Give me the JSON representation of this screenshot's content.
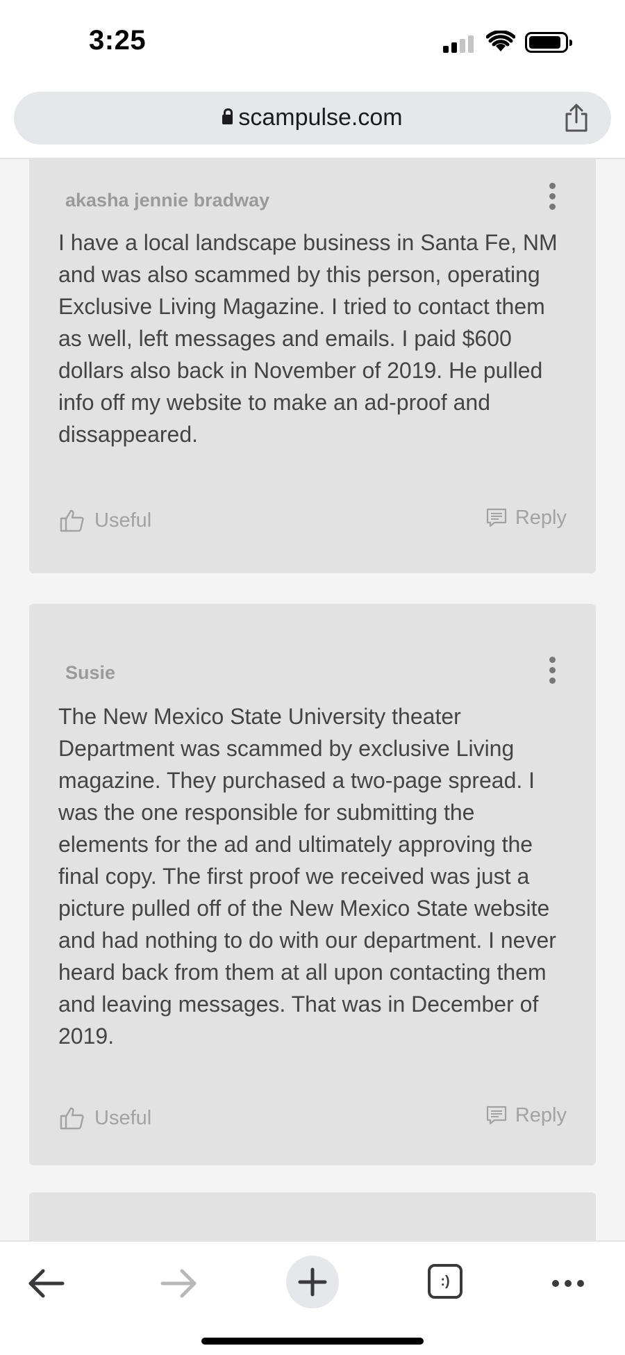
{
  "status_bar": {
    "time": "3:25"
  },
  "browser": {
    "url": "scampulse.com"
  },
  "comments": [
    {
      "author": "akasha jennie bradway",
      "body": "I have a local landscape business in Santa Fe, NM and was also scammed by this person, operating Exclusive Living Magazine. I tried to contact them as well, left messages and emails. I paid $600 dollars also back in November of 2019. He pulled info off my website to make an ad-proof and dissappeared.",
      "useful_label": "Useful",
      "reply_label": "Reply"
    },
    {
      "author": "Susie",
      "body": "The New Mexico State University theater Department was scammed by exclusive Living magazine. They purchased a two-page spread. I was the one responsible for submitting the elements for the ad and ultimately approving the final copy. The first proof we received was just a picture pulled off of the New Mexico State website and had nothing to do with our department. I never heard back from them at all upon contacting them and leaving messages. That was in December of 2019.",
      "useful_label": "Useful",
      "reply_label": "Reply"
    }
  ],
  "toolbar": {
    "tabs_label": ":)"
  },
  "icons": {
    "status": [
      "signal-icon",
      "wifi-icon",
      "battery-icon"
    ],
    "url_bar": [
      "lock-icon",
      "share-icon"
    ],
    "card": [
      "more-options-icon",
      "thumbs-up-icon",
      "reply-icon"
    ],
    "bottom_bar": [
      "back-arrow-icon",
      "forward-arrow-icon",
      "plus-icon",
      "tabs-icon",
      "more-icon"
    ]
  },
  "colors": {
    "card_background": "#e2e2e2",
    "page_background": "#f4f4f5",
    "url_bar_background": "#e6e7ea"
  }
}
